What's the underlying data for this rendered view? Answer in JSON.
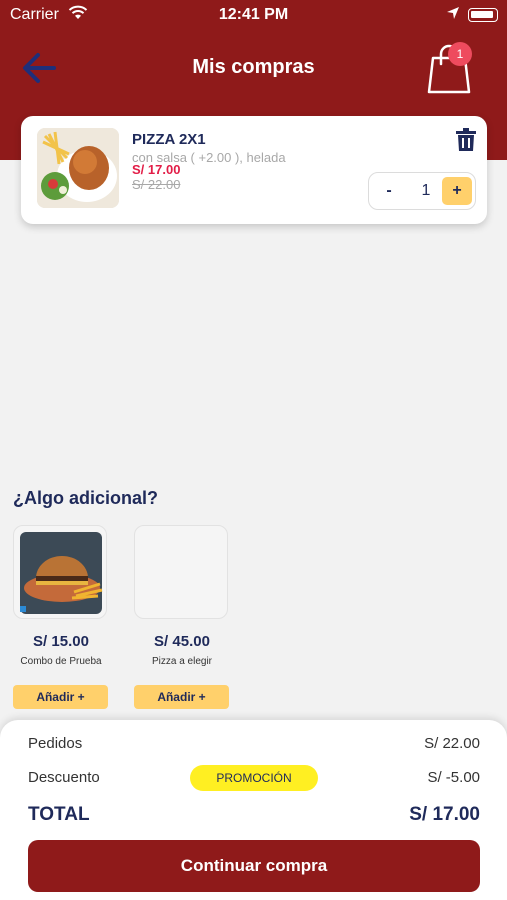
{
  "statusbar": {
    "carrier": "Carrier",
    "time": "12:41 PM"
  },
  "header": {
    "title": "Mis compras",
    "cart_count": "1"
  },
  "cart_item": {
    "name": "PIZZA 2X1",
    "options": "con salsa ( +2.00 ), helada",
    "price": "S/ 17.00",
    "old_price": "S/ 22.00",
    "quantity": "1",
    "minus": "-",
    "plus": "+"
  },
  "extras": {
    "title": "¿Algo adicional?",
    "items": [
      {
        "price": "S/ 15.00",
        "name": "Combo de Prueba",
        "add_label": "Añadir +"
      },
      {
        "price": "S/ 45.00",
        "name": "Pizza a elegir",
        "add_label": "Añadir +"
      }
    ]
  },
  "summary": {
    "orders_label": "Pedidos",
    "orders_value": "S/ 22.00",
    "discount_label": "Descuento",
    "promo_badge": "PROMOCIÓN",
    "discount_value": "S/ -5.00",
    "total_label": "TOTAL",
    "total_value": "S/ 17.00",
    "continue_label": "Continuar compra"
  },
  "colors": {
    "primary": "#8f1a1a",
    "accent": "#ffd06b",
    "promo": "#ffef22",
    "price": "#e21d47",
    "text": "#1f2a5a"
  }
}
